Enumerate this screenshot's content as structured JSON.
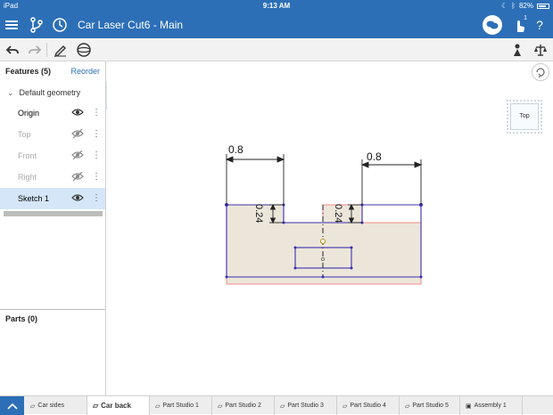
{
  "status": {
    "device": "iPad",
    "time": "9:13 AM",
    "battery": "82%",
    "battery_level": 0.82
  },
  "app": {
    "document_title": "Car Laser Cut6",
    "separator": " - ",
    "workspace": "Main",
    "notification_count": "1",
    "help": "?"
  },
  "features": {
    "header": "Features (5)",
    "reorder": "Reorder",
    "group": "Default geometry",
    "items": [
      {
        "label": "Origin",
        "visible": true
      },
      {
        "label": "Top",
        "visible": false
      },
      {
        "label": "Front",
        "visible": false
      },
      {
        "label": "Right",
        "visible": false
      },
      {
        "label": "Sketch 1",
        "visible": true,
        "selected": true
      }
    ]
  },
  "parts": {
    "header": "Parts (0)"
  },
  "viewcube": {
    "face": "Top"
  },
  "sketch": {
    "dims": {
      "left_width": "0.8",
      "right_width": "0.8",
      "left_depth": "0.24",
      "right_depth": "0.24"
    }
  },
  "tabs": [
    {
      "label": "Car sides"
    },
    {
      "label": "Car back",
      "active": true
    },
    {
      "label": "Part Studio 1"
    },
    {
      "label": "Part Studio 2"
    },
    {
      "label": "Part Studio 3"
    },
    {
      "label": "Part Studio 4"
    },
    {
      "label": "Part Studio 5"
    },
    {
      "label": "Assembly 1"
    }
  ],
  "colors": {
    "brand": "#2c6fb7",
    "sketch_fill": "#ece6da",
    "sketch_line": "#3a2fb0",
    "region_outline": "#f08a8a",
    "selection": "#d4e6f7"
  }
}
